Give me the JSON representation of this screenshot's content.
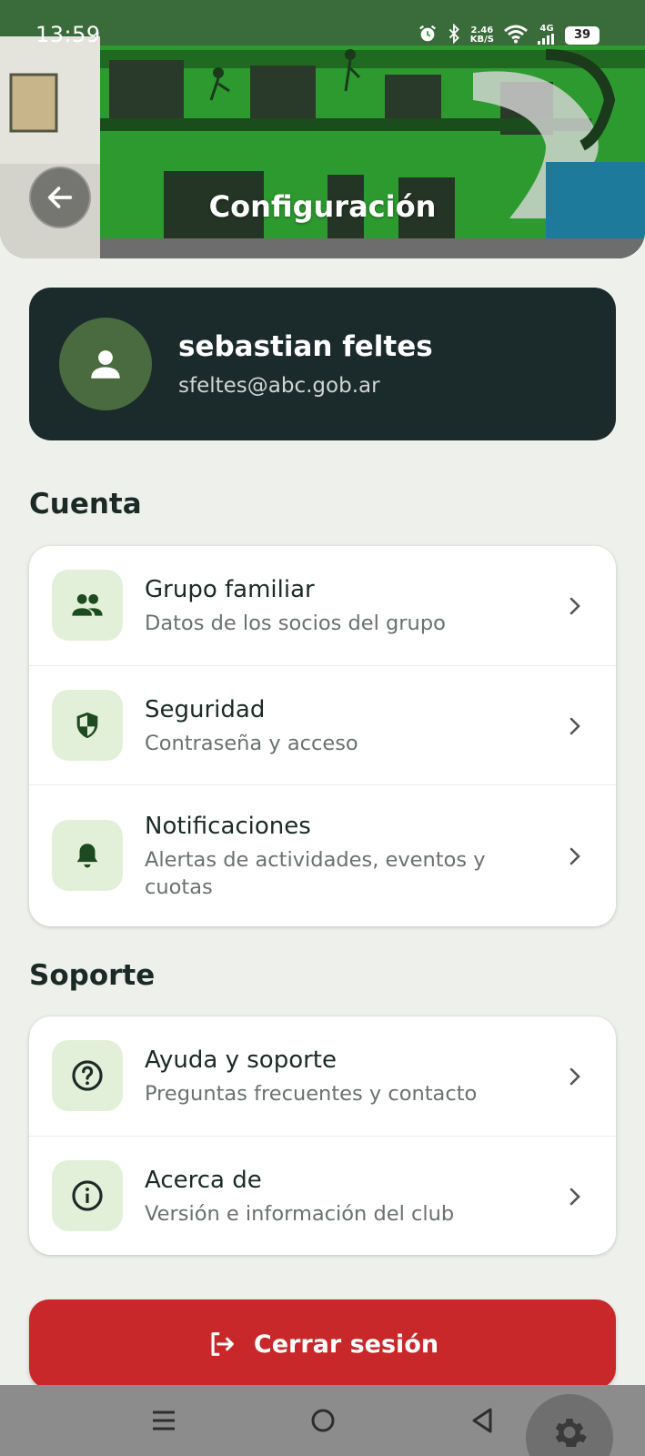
{
  "status_bar": {
    "time": "13:59",
    "net_speed_value": "2.46",
    "net_speed_unit": "KB/S",
    "network_type": "4G",
    "battery_level": "39"
  },
  "header": {
    "title": "Configuración",
    "back_icon": "arrow-left-icon"
  },
  "profile": {
    "name": "sebastian feltes",
    "email": "sfeltes@abc.gob.ar",
    "avatar_icon": "person-icon"
  },
  "sections": {
    "account": {
      "title": "Cuenta",
      "items": [
        {
          "title": "Grupo familiar",
          "subtitle": "Datos de los socios del grupo",
          "icon": "group-icon"
        },
        {
          "title": "Seguridad",
          "subtitle": "Contraseña y acceso",
          "icon": "shield-icon"
        },
        {
          "title": "Notificaciones",
          "subtitle": "Alertas de actividades, eventos y cuotas",
          "icon": "bell-icon"
        }
      ]
    },
    "support": {
      "title": "Soporte",
      "items": [
        {
          "title": "Ayuda y soporte",
          "subtitle": "Preguntas frecuentes y contacto",
          "icon": "help-circle-icon"
        },
        {
          "title": "Acerca de",
          "subtitle": "Versión e información del club",
          "icon": "info-circle-icon"
        }
      ]
    }
  },
  "logout": {
    "label": "Cerrar sesión",
    "icon": "logout-icon"
  },
  "colors": {
    "accent_green": "#1d4a1f",
    "icon_bg": "#e3f0d9",
    "profile_bg": "#1b2a2b",
    "logout_red": "#c8282a",
    "page_bg": "#eef0ec"
  }
}
